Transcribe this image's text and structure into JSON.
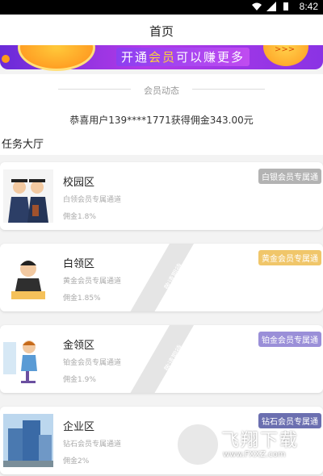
{
  "status_bar": {
    "time": "8:42"
  },
  "header": {
    "title": "首页"
  },
  "banner": {
    "text_prefix": "开通",
    "text_highlight": "会员",
    "text_suffix": "可以赚更多",
    "more": ">>>"
  },
  "member_news": {
    "section_title": "会员动态",
    "message": "恭喜用户139****1771获得佣金343.00元"
  },
  "task_hall": {
    "title": "任务大厅"
  },
  "cards": [
    {
      "name": "校园区",
      "desc": "白领会员专属通道",
      "rate": "佣金1.8%",
      "badge": "白银会员专属通",
      "badge_color": "#b3b3b3",
      "icon": "graduates-illustration"
    },
    {
      "name": "白领区",
      "desc": "黄金会员专属通道",
      "rate": "佣金1.85%",
      "badge": "黄金会员专属通",
      "badge_color": "#f0c66a",
      "icon": "office-worker-illustration",
      "stamp": "敬请期待"
    },
    {
      "name": "金领区",
      "desc": "铂金会员专属通道",
      "rate": "佣金1.9%",
      "badge": "铂金会员专属通",
      "badge_color": "#9a8fd8",
      "icon": "receptionist-illustration",
      "stamp": "敬请期待"
    },
    {
      "name": "企业区",
      "desc": "钻石会员专属通道",
      "rate": "佣金2%",
      "badge": "钻石会员专属通",
      "badge_color": "#6b6fb0",
      "icon": "building-illustration"
    }
  ],
  "watermark": {
    "brand": "飞翔下载",
    "url": "www.FXXZ.com"
  }
}
